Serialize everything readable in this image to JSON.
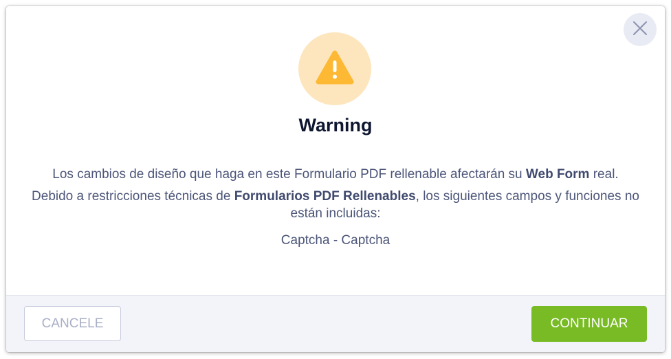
{
  "dialog": {
    "title": "Warning",
    "icon": "warning-icon",
    "close_icon": "close-icon",
    "colors": {
      "icon_bg": "#fde6be",
      "icon_fg": "#fdb934",
      "continue_bg": "#78bb24"
    },
    "message1": {
      "before": "Los cambios de diseño que haga en este Formulario PDF rellenable afectarán su ",
      "bold": "Web Form",
      "after": " real."
    },
    "message2": {
      "before": "Debido a restricciones técnicas de ",
      "bold": "Formularios PDF Rellenables",
      "after": ", los siguientes campos y funciones no están incluidas:"
    },
    "excluded_fields": "Captcha - Captcha"
  },
  "footer": {
    "cancel_label": "CANCELE",
    "continue_label": "CONTINUAR"
  }
}
